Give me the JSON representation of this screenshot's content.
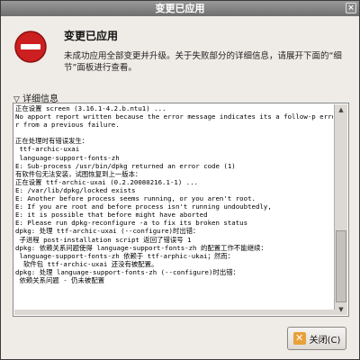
{
  "window": {
    "title": "变更已应用",
    "close_glyph": "×"
  },
  "header": {
    "icon": "stop-icon",
    "heading": "变更已应用",
    "message": "未成功应用全部变更并升级。关于失败部分的详细信息，请展开下面的“细节”面板进行查看。"
  },
  "details": {
    "toggle_label": "详细信息",
    "log": "正在设置 screen (3.16.1-4.2.b.ntu1) ...\nNo apport report written because the error message indicates its a follow-p erro\nr from a previous failure.\n\n正在处理时有错误发生：\n ttf-archic-uxai\n language-support-fonts-zh\nE: Sub-process /usr/bin/dpkg returned an error code (1)\n有软件包无法安装，试图恢复到上一版本：\n正在设置 ttf-archic-uxai (0.2.20080216.1-1) ...\nE: /var/lib/dpkg/locked exists\nE: Another before process seems running, or you aren't root.\nE: If you are root and before process isn't running undoubtedly,\nE: it is possible that before might have aborted\nE: Please run dpkg-reconfigure -a to fix its broken status\ndpkg: 处理 ttf-archic-uxai (--configure)时出错：\n 子进程 post-installation script 返回了错误号 1\ndpkg: 依赖关系问题使得 language-support-fonts-zh 的配置工作不能继续：\n language-support-fonts-zh 依赖于 ttf-arphic-ukai；然而：\n  软件包 ttf-archic-uxai 还没有被配置。\ndpkg: 处理 language-support-fonts-zh (--configure)时出错：\n 依赖关系问题 - 仍未被配置"
  },
  "footer": {
    "close_label": "关闭(C)",
    "close_icon": "x-icon"
  },
  "colors": {
    "stop_red": "#cc1f1f",
    "close_icon_orange": "#e8a13a"
  }
}
